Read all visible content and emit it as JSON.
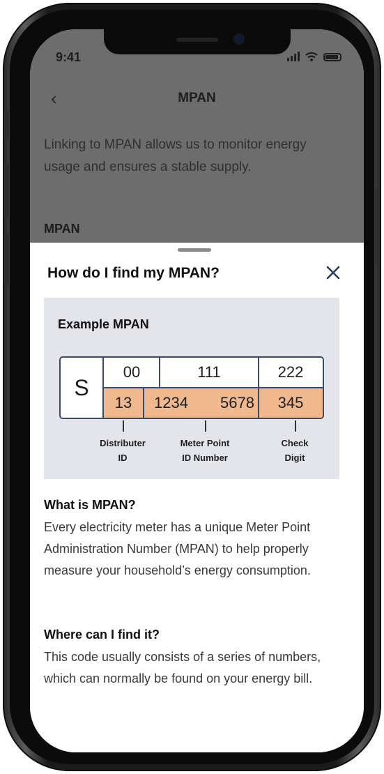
{
  "status_bar": {
    "time": "9:41"
  },
  "nav": {
    "title": "MPAN"
  },
  "background_page": {
    "description": "Linking to MPAN allows us to monitor energy usage and ensures a stable supply.",
    "field_label": "MPAN"
  },
  "sheet": {
    "title": "How do I find my MPAN?",
    "example": {
      "title": "Example MPAN",
      "prefix": "S",
      "top_row": [
        "00",
        "111",
        "222"
      ],
      "bottom_row": [
        "13",
        "1234",
        "5678",
        "345"
      ],
      "captions": [
        {
          "line1": "Distributer",
          "line2": "ID"
        },
        {
          "line1": "Meter Point",
          "line2": "ID Number"
        },
        {
          "line1": "Check",
          "line2": "Digit"
        }
      ]
    },
    "what_heading": "What is MPAN?",
    "what_body": "Every electricity meter has a unique Meter Point Administration Number (MPAN) to help properly measure your household’s energy consumption.",
    "where_heading": "Where can I find it?",
    "where_body": "This code usually consists of a series of numbers, which can normally be found on your energy bill."
  },
  "colors": {
    "highlight": "#f0b98d",
    "card": "#e4e5ea",
    "overlay": "#6d6d6d"
  }
}
